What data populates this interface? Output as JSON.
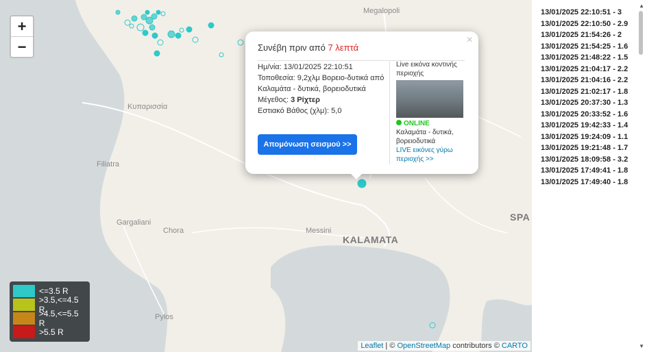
{
  "map": {
    "places": [
      {
        "id": "megalopoli",
        "name": "Megalopoli",
        "style": "normal"
      },
      {
        "id": "kyparissia",
        "name": "Κυπαρισσία",
        "style": "normal"
      },
      {
        "id": "filiatra",
        "name": "Filiatra",
        "style": "normal"
      },
      {
        "id": "gargaliani",
        "name": "Gargaliani",
        "style": "normal"
      },
      {
        "id": "chora",
        "name": "Chora",
        "style": "normal"
      },
      {
        "id": "messini",
        "name": "Messini",
        "style": "normal"
      },
      {
        "id": "kalamata",
        "name": "KALAMATA",
        "style": "big"
      },
      {
        "id": "pylos",
        "name": "Pylos",
        "style": "normal"
      },
      {
        "id": "spa",
        "name": "SPA",
        "style": "big"
      }
    ],
    "zoom_in": "+",
    "zoom_out": "−",
    "attribution": {
      "leaflet": "Leaflet",
      "sep": " | © ",
      "osm": "OpenStreetMap",
      "contrib": " contributors © ",
      "carto": "CARTO"
    }
  },
  "legend": [
    {
      "label": "<=3.5 R",
      "color": "#2ec9c9"
    },
    {
      "label": ">3.5,<=4.5 R",
      "color": "#b8c41a"
    },
    {
      "label": ">4.5,<=5.5 R",
      "color": "#c8861a"
    },
    {
      "label": ">5.5 R",
      "color": "#c81a1a"
    }
  ],
  "popup": {
    "close": "×",
    "happened_prefix": "Συνέβη πριν από ",
    "happened_minutes": "7 λεπτά",
    "date": "Ημ/νία: 13/01/2025 22:10:51",
    "location": "Τοποθεσία: 9,2χλμ Βορειο-δυτικά από Καλαμάτα - δυτικά, βορειοδυτικά",
    "magnitude_label": "Μέγεθος: ",
    "magnitude_value": "3 Ρίχτερ",
    "depth": "Εστιακό Βάθος (χλμ): 5,0",
    "isolate_button": "Απομόνωση σεισμού >>",
    "live_title": "Live εικόνα κοντινής περιοχής",
    "online": "ONLINE",
    "cam_location": "Καλαμάτα - δυτικά, βορειοδυτικά",
    "live_link": "LIVE εικόνες γύρω περιοχής >>"
  },
  "quakes": [
    "13/01/2025 22:10:51 - 3",
    "13/01/2025 22:10:50 - 2.9",
    "13/01/2025 21:54:26 - 2",
    "13/01/2025 21:54:25 - 1.6",
    "13/01/2025 21:48:22 - 1.5",
    "13/01/2025 21:04:17 - 2.2",
    "13/01/2025 21:04:16 - 2.2",
    "13/01/2025 21:02:17 - 1.8",
    "13/01/2025 20:37:30 - 1.3",
    "13/01/2025 20:33:52 - 1.6",
    "13/01/2025 19:42:33 - 1.4",
    "13/01/2025 19:24:09 - 1.1",
    "13/01/2025 19:21:48 - 1.7",
    "13/01/2025 18:09:58 - 3.2",
    "13/01/2025 17:49:41 - 1.8",
    "13/01/2025 17:49:40 - 1.8"
  ]
}
